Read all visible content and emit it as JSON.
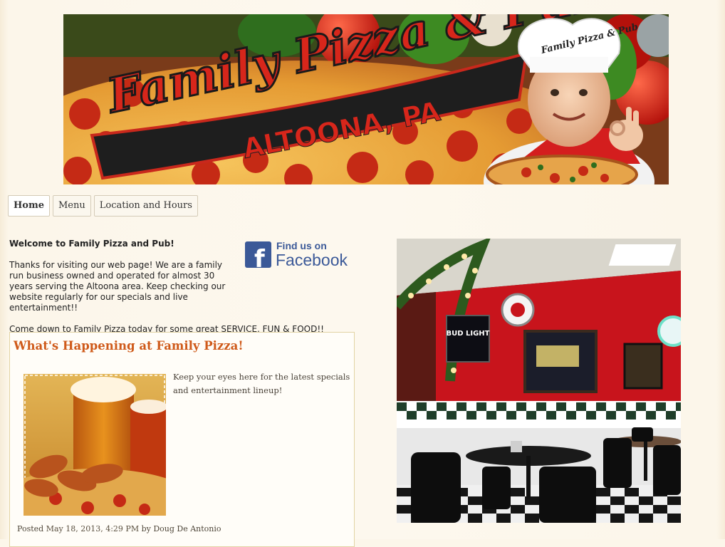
{
  "header": {
    "banner_title": "Family Pizza & Pub",
    "banner_location": "ALTOONA, PA",
    "hat_logo": "Family Pizza & Pub"
  },
  "nav": {
    "tabs": [
      "Home",
      "Menu",
      "Location and Hours"
    ],
    "active": "Home"
  },
  "welcome": {
    "heading": "Welcome to Family Pizza and Pub!",
    "paragraph1": "Thanks for visiting our web page!  We are a family run business owned and operated for almost 30 years serving the Altoona area.  Keep checking our website regularly for our specials and live entertainment!!",
    "paragraph2": "Come down to Family Pizza today for some great SERVICE, FUN & FOOD!!"
  },
  "facebook": {
    "line1": "Find us on",
    "line2": "Facebook",
    "icon": "facebook-icon"
  },
  "happening": {
    "title": "What's Happening at Family Pizza!",
    "body": "Keep your eyes here for the latest specials and entertainment lineup!",
    "posted_prefix": "Posted",
    "posted_date": "May 18, 2013, 4:29 PM",
    "posted_by_prefix": "by",
    "author": "Doug De Antonio"
  },
  "photo": {
    "sign": "BUD LIGHT"
  },
  "colors": {
    "background": "#fcf6ea",
    "accent_orange": "#cf5a1a",
    "wall_red": "#c8141c",
    "facebook_blue": "#3b5998"
  }
}
